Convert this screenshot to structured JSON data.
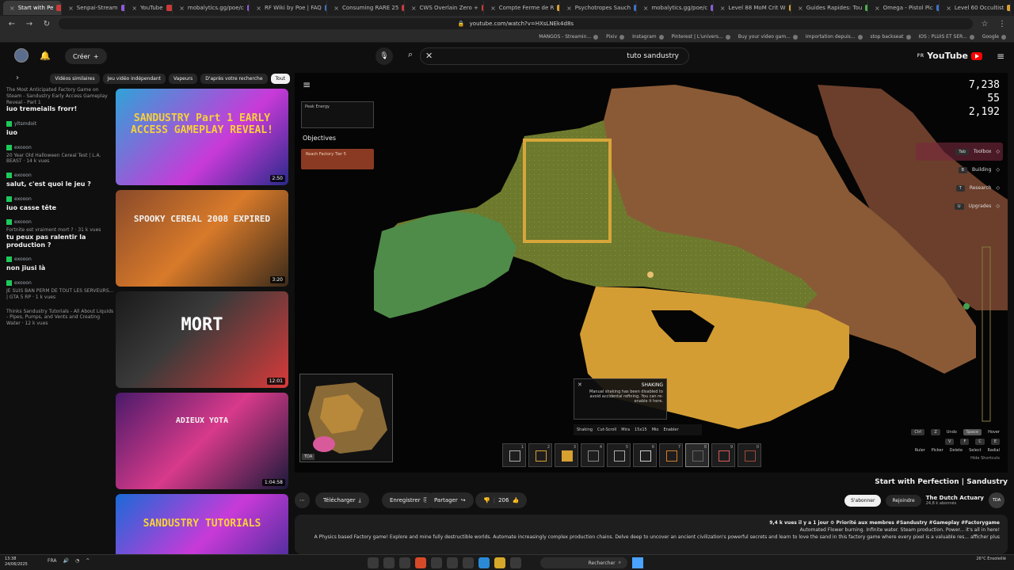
{
  "browser": {
    "tabs": [
      {
        "label": "Level 60 Occultist",
        "color": "y"
      },
      {
        "label": "Omega - Pistol Pic",
        "color": "b"
      },
      {
        "label": "Guides Rapides: Tou",
        "color": "g"
      },
      {
        "label": "Level 88 MoM Crit W",
        "color": "y"
      },
      {
        "label": "mobalytics.gg/poe/c",
        "color": "p"
      },
      {
        "label": "Psychotropes Sauch",
        "color": "b"
      },
      {
        "label": "Compte Ferme de R",
        "color": "y"
      },
      {
        "label": "CWS Overlain Zero +",
        "color": "r"
      },
      {
        "label": "Consuming RARE 25",
        "color": "r"
      },
      {
        "label": "RF Wiki by Poe | FAQ",
        "color": "b"
      },
      {
        "label": "mobalytics.gg/poe/c",
        "color": "p"
      },
      {
        "label": "YouTube",
        "color": "r"
      },
      {
        "label": "Senpai-Stream",
        "color": "p"
      },
      {
        "label": "Start with Pe",
        "color": "r",
        "active": true
      }
    ],
    "url": "youtube.com/watch?v=HXsLNEk4d8s",
    "bookmarks": [
      "Google",
      "IOS : PLUIS ET SER...",
      "stop backseat",
      "Importation depuis...",
      "Buy your video gam...",
      "Pinterest | L'univers...",
      "Instagram",
      "Pixiv",
      "MANGOS - Streamin..."
    ]
  },
  "header": {
    "logo_text": "YouTube",
    "logo_region": "FR",
    "search_value": "tuto sandustry",
    "create_label": "Créer",
    "mic_icon": "mic-icon",
    "search_icon": "search-icon"
  },
  "chips": [
    "Tout",
    "D'après votre recherche",
    "Vapeurs",
    "Jeu vidéo indépendant",
    "Vidéos similaires"
  ],
  "chat": [
    {
      "user": "",
      "text": "iuo tremeiails frorr!",
      "sub": "The Most Anticipated Factory Game on Steam - Sandustry Early Access Gameplay Reveal - Part 1"
    },
    {
      "user": "yltsmdoit",
      "text": "iuo"
    },
    {
      "user": "exooon",
      "text": "",
      "sub": "20 Year Old Halloween Cereal Test | L.A. BEAST · 14 k vues"
    },
    {
      "user": "exooon",
      "text": "salut, c'est quoi le jeu ?"
    },
    {
      "user": "exooon",
      "text": "iuo casse tête"
    },
    {
      "user": "exooon",
      "text": "tu peux pas ralentir la production ?",
      "sub": "Fortnite est vraiment mort ? · 31 k vues"
    },
    {
      "user": "exooon",
      "text": "non jiusi là"
    },
    {
      "user": "exooon",
      "text": "",
      "sub": "JE SUIS BAN PERM DE TOUT LES SERVEURS... | GTA 5 RP · 1 k vues"
    },
    {
      "user": "",
      "text": "",
      "sub": "Thinks Sandustry Tutorials - All About Liquids - Pipes, Pumps, and Vents and Creating Water · 12 k vues"
    }
  ],
  "related": [
    {
      "title": "SANDUSTRY Part 1 EARLY ACCESS GAMEPLAY REVEAL!",
      "duration": "2:50"
    },
    {
      "title": "SPOOKY CEREAL 2008 EXPIRED",
      "duration": "3:20"
    },
    {
      "title": "MORT",
      "duration": "12:01"
    },
    {
      "title": "ADIEUX YOTA",
      "duration": "1:04:58"
    },
    {
      "title": "SANDUSTRY TUTORIALS",
      "duration": "15:24"
    }
  ],
  "game": {
    "stats": [
      "7,238",
      "55",
      "2,192"
    ],
    "objectives_title": "Objectives",
    "objective_card": "Reach Factory Tier 5",
    "peak_energy": "Peak Energy",
    "menu": [
      {
        "label": "Toolbox",
        "key": "Tab"
      },
      {
        "label": "Building",
        "key": "B"
      },
      {
        "label": "Research",
        "key": "T"
      },
      {
        "label": "Upgrades",
        "key": "U"
      }
    ],
    "tooltip_title": "SHAKING",
    "tooltip_text": "Manual shaking has been disabled to avoid accidental refining. You can re-enable it here.",
    "toolbar": [
      "Shaking",
      "Cut-Scroll",
      "Mira",
      "15x15",
      "Mio",
      "Enabler"
    ],
    "tool_rows": [
      [
        "Ctrl",
        "Z",
        "Undo",
        "Space",
        "Hover"
      ],
      [
        "V",
        "F",
        "C",
        "E"
      ],
      [
        "Ruler",
        "Picker",
        "Delete",
        "Select",
        "Radial"
      ]
    ],
    "hide_shortcuts": "Hide Shortcuts"
  },
  "video": {
    "title": "Start with Perfection | Sandustry",
    "channel_name": "The Dutch Actuary",
    "channel_short": "TDA",
    "channel_subs": "24,8 k abonnés",
    "join_label": "Rejoindre",
    "subscribe_label": "S'abonner",
    "like_count": "206",
    "share_label": "Partager",
    "save_label": "Enregistrer",
    "download_label": "Télécharger",
    "desc_meta": "9,4 k vues  il y a 1 jour  ⚙ Priorité aux membres  #Sandustry #Gameplay #Factorygame",
    "desc_line1": "Automated Flower burning. Infinite water. Steam production. Power... it's all in here!",
    "desc_line2": "A Physics based Factory game! Explore and mine fully destructible worlds. Automate increasingly complex production chains. Delve deep to uncover an ancient civilization's powerful secrets and learn to love the sand in this factory game where every pixel is a valuable res... afficher plus"
  },
  "taskbar": {
    "search_label": "Rechercher",
    "clock_time": "13:38",
    "clock_date": "24/06/2025",
    "lang": "FRA",
    "weather": "26°C Ensoleillé"
  },
  "colors": {
    "accent": "#ff0000",
    "sand": "#e1a43b",
    "olive": "#8a9a3a",
    "green_sand": "#5aa04a",
    "brown_sand": "#7a4d28"
  }
}
